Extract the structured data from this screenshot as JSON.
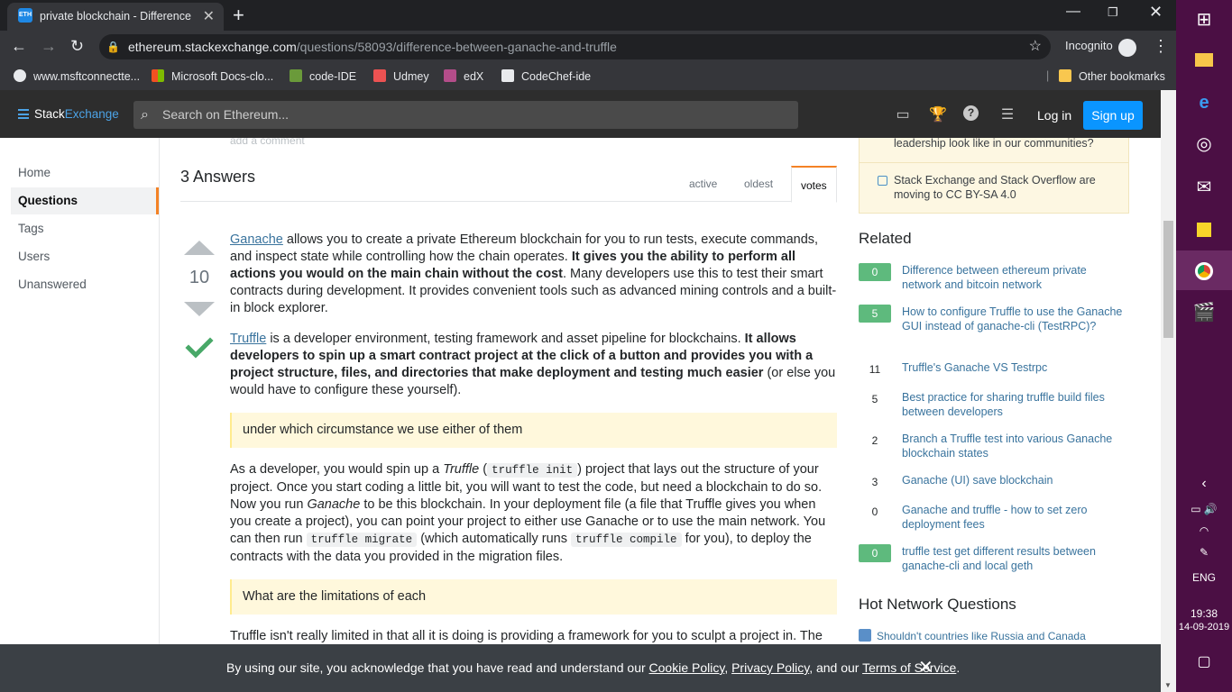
{
  "browser": {
    "tab_title": "private blockchain - Difference b",
    "tab_favicon_text": "ETH",
    "url_host": "ethereum.stackexchange.com",
    "url_path": "/questions/58093/difference-between-ganache-and-truffle",
    "incognito_label": "Incognito",
    "bookmarks": [
      "www.msftconnectte...",
      "Microsoft Docs-clo...",
      "code-IDE",
      "Udmey",
      "edX",
      "CodeChef-ide"
    ],
    "other_bookmarks": "Other bookmarks"
  },
  "header": {
    "logo_stack": "Stack",
    "logo_exchange": "Exchange",
    "search_placeholder": "Search on Ethereum...",
    "login": "Log in",
    "signup": "Sign up"
  },
  "leftnav": {
    "items": [
      "Home",
      "Questions",
      "Tags",
      "Users",
      "Unanswered"
    ],
    "active": "Questions"
  },
  "main": {
    "add_comment": "add a comment",
    "answers_heading": "3 Answers",
    "sort_tabs": [
      "active",
      "oldest",
      "votes"
    ],
    "active_sort": "votes",
    "vote_count": "10",
    "p1_link": "Ganache",
    "p1_a": " allows you to create a private Ethereum blockchain for you to run tests, execute commands, and inspect state while controlling how the chain operates. ",
    "p1_bold": "It gives you the ability to perform all actions you would on the main chain without the cost",
    "p1_b": ". Many developers use this to test their smart contracts during development. It provides convenient tools such as advanced mining controls and a built-in block explorer.",
    "p2_link": "Truffle",
    "p2_a": " is a developer environment, testing framework and asset pipeline for blockchains. ",
    "p2_bold": "It allows developers to spin up a smart contract project at the click of a button and provides you with a project structure, files, and directories that make deployment and testing much easier",
    "p2_b": " (or else you would have to configure these yourself).",
    "quote1": "under which circumstance we use either of them",
    "p3_a": "As a developer, you would spin up a ",
    "p3_em1": "Truffle",
    "p3_b": " (",
    "p3_code1": "truffle init",
    "p3_c": ") project that lays out the structure of your project. Once you start coding a little bit, you will want to test the code, but need a blockchain to do so. Now you run ",
    "p3_em2": "Ganache",
    "p3_d": " to be this blockchain. In your deployment file (a file that Truffle gives you when you create a project), you can point your project to either use Ganache or to use the main network. You can then run ",
    "p3_code2": "truffle migrate",
    "p3_e": " (which automatically runs ",
    "p3_code3": "truffle compile",
    "p3_f": " for you), to deploy the contracts with the data you provided in the migration files.",
    "quote2": "What are the limitations of each",
    "p4": "Truffle isn't really limited in that all it is doing is providing a framework for you to sculpt a project in. The only \"limitation\" would simply be the features they may not have added yet."
  },
  "sidebar": {
    "blog_items": [
      "leadership look like in our communities?",
      "Stack Exchange and Stack Overflow are moving to CC BY-SA 4.0"
    ],
    "related_heading": "Related",
    "related": [
      {
        "score": "0",
        "answered": true,
        "title": "Difference between ethereum private network and bitcoin network"
      },
      {
        "score": "5",
        "answered": true,
        "title": "How to configure Truffle to use the Ganache GUI instead of ganache-cli (TestRPC)?"
      },
      {
        "score": "11",
        "answered": false,
        "title": "Truffle's Ganache VS Testrpc"
      },
      {
        "score": "5",
        "answered": false,
        "title": "Best practice for sharing truffle build files between developers"
      },
      {
        "score": "2",
        "answered": false,
        "title": "Branch a Truffle test into various Ganache blockchain states"
      },
      {
        "score": "3",
        "answered": false,
        "title": "Ganache (UI) save blockchain"
      },
      {
        "score": "0",
        "answered": false,
        "title": "Ganache and truffle - how to set zero deployment fees"
      },
      {
        "score": "0",
        "answered": true,
        "title": "truffle test get different results between ganache-cli and local geth"
      }
    ],
    "hnq_heading": "Hot Network Questions",
    "hnq_first": "Shouldn't countries like Russia and Canada"
  },
  "cookie": {
    "text_a": "By using our site, you acknowledge that you have read and understand our ",
    "link1": "Cookie Policy",
    "sep1": ", ",
    "link2": "Privacy Policy",
    "text_b": ", and our ",
    "link3": "Terms of Service",
    "text_c": "."
  },
  "taskbar": {
    "lang": "ENG",
    "time": "19:38",
    "date": "14-09-2019"
  },
  "colors": {
    "accent": "#0a95ff",
    "accepted": "#48a868",
    "taskbar": "#4b0f44"
  }
}
